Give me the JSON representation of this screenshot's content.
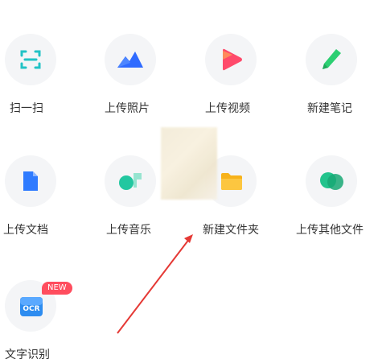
{
  "grid": {
    "items": [
      {
        "id": "scan",
        "label": "扫一扫",
        "icon": "scan-icon"
      },
      {
        "id": "photo",
        "label": "上传照片",
        "icon": "photo-icon"
      },
      {
        "id": "video",
        "label": "上传视频",
        "icon": "video-play-icon"
      },
      {
        "id": "note",
        "label": "新建笔记",
        "icon": "pen-icon"
      },
      {
        "id": "doc",
        "label": "上传文档",
        "icon": "document-icon"
      },
      {
        "id": "music",
        "label": "上传音乐",
        "icon": "music-icon"
      },
      {
        "id": "folder",
        "label": "新建文件夹",
        "icon": "folder-icon"
      },
      {
        "id": "other",
        "label": "上传其他文件",
        "icon": "other-files-icon"
      },
      {
        "id": "ocr",
        "label": "文字识别",
        "icon": "ocr-icon",
        "badge": "NEW",
        "icon_text": "OCR"
      }
    ]
  },
  "colors": {
    "scan": "#22c3c6",
    "photo": "#2f6bff",
    "video": "#ff4a6b",
    "note": "#2ccf72",
    "doc": "#2f7bff",
    "music": "#22c7a0",
    "folder": "#f7b21a",
    "other": "#22c38c",
    "ocr": "#2d8cf0",
    "badge": "#ff4d5e",
    "annotation_arrow": "#e53935"
  }
}
